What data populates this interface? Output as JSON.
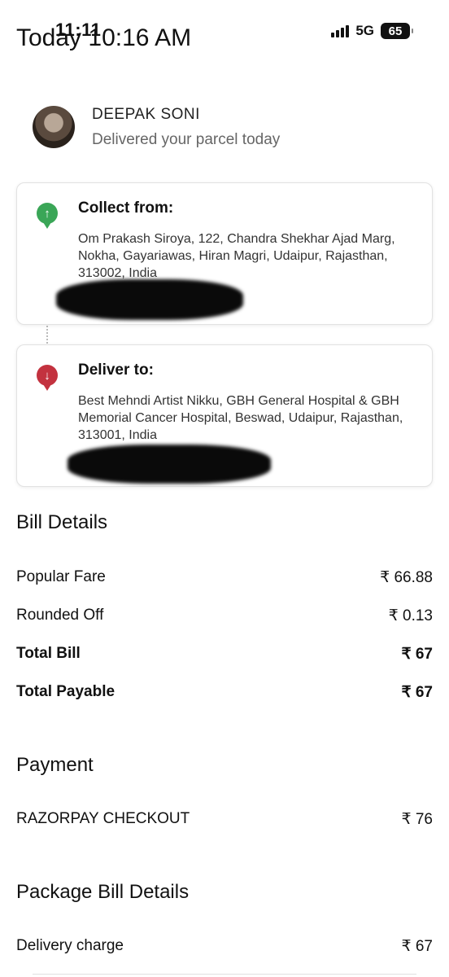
{
  "status_bar": {
    "time": "11:11",
    "network": "5G",
    "battery": "65"
  },
  "header": {
    "title": "Today 10:16 AM"
  },
  "driver": {
    "name": "DEEPAK  SONI",
    "subtitle": "Delivered your parcel today"
  },
  "pickup": {
    "title": "Collect from:",
    "address": "Om Prakash Siroya, 122, Chandra Shekhar Ajad Marg, Nokha, Gayariawas, Hiran Magri, Udaipur, Rajasthan, 313002, India",
    "icon": "arrow-up-pin-icon"
  },
  "drop": {
    "title": "Deliver to:",
    "address": "Best Mehndi Artist Nikku, GBH General Hospital & GBH Memorial Cancer Hospital, Beswad, Udaipur, Rajasthan, 313001, India",
    "icon": "arrow-down-pin-icon"
  },
  "bill": {
    "title": "Bill Details",
    "rows": [
      {
        "label": "Popular Fare",
        "value": "₹ 66.88"
      },
      {
        "label": "Rounded Off",
        "value": "₹ 0.13"
      },
      {
        "label": "Total Bill",
        "value": "₹ 67"
      },
      {
        "label": "Total Payable",
        "value": "₹ 67"
      }
    ]
  },
  "payment": {
    "title": "Payment",
    "rows": [
      {
        "label": "RAZORPAY CHECKOUT",
        "value": "₹ 76"
      }
    ]
  },
  "package_bill": {
    "title": "Package Bill Details",
    "rows": [
      {
        "label": "Delivery charge",
        "value": "₹ 67"
      }
    ]
  },
  "colors": {
    "pickup_pin": "#3aa657",
    "drop_pin": "#c3323f"
  }
}
